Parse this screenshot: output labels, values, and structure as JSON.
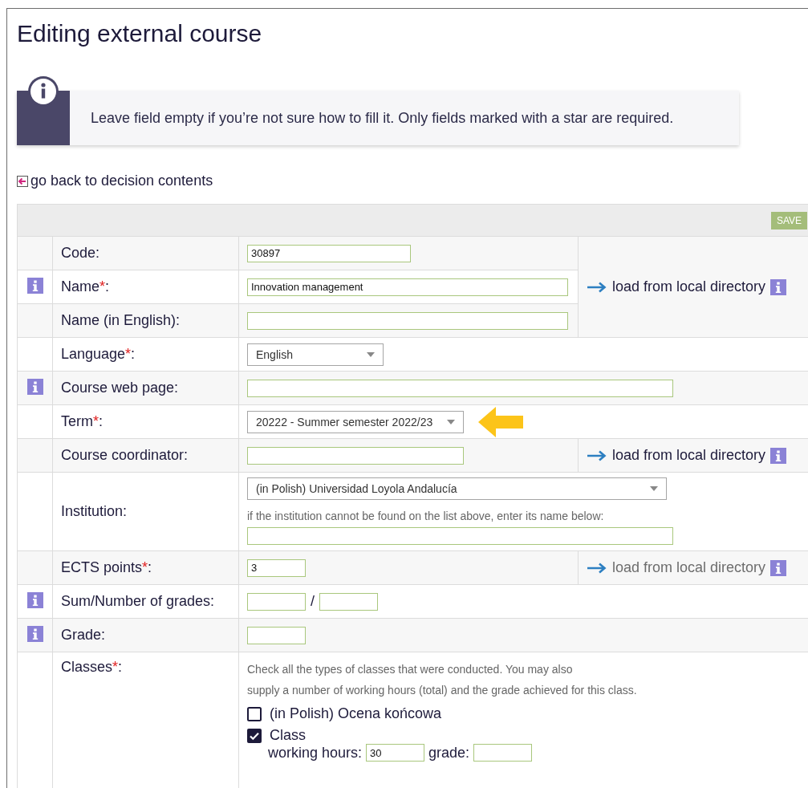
{
  "page": {
    "title": "Editing external course"
  },
  "notice": {
    "text": "Leave field empty if you’re not sure how to fill it. Only fields marked with a star are required."
  },
  "back_link": {
    "label": "go back to decision contents"
  },
  "form": {
    "save_button": "SAVE",
    "rows": [
      {
        "kind": "group",
        "side": {
          "label": "load from local directory",
          "disabled": false
        },
        "rows": [
          {
            "kind": "text",
            "label": "Code:",
            "info": false,
            "marked": false,
            "value": "30897"
          },
          {
            "kind": "text",
            "label": "Name",
            "required_mark": "*",
            "label_end": ":",
            "info": true,
            "marked": false,
            "value": "Innovation management"
          },
          {
            "kind": "text",
            "label": "Name (in English):",
            "info": false,
            "marked": false
          }
        ]
      },
      {
        "kind": "select",
        "label": "Language",
        "required_mark": "*",
        "label_end": ":",
        "info": false,
        "marked": false,
        "value": "English"
      },
      {
        "kind": "text",
        "label": "Course web page:",
        "info": true,
        "marked": false
      },
      {
        "kind": "select",
        "label": "Term",
        "required_mark": "*",
        "label_end": ":",
        "info": false,
        "marked": true,
        "value": "20222 - Summer semester 2022/23"
      },
      {
        "kind": "text",
        "label": "Course coordinator:",
        "info": false,
        "marked": false,
        "side": {
          "label": "load from local directory",
          "disabled": false
        }
      },
      {
        "kind": "institution",
        "label": "Institution:",
        "info": false,
        "marked": false,
        "value": "(in Polish) Universidad Loyola Andalucía",
        "hint": "if the institution cannot be found on the list above, enter its name below:"
      },
      {
        "kind": "text",
        "label": "ECTS points",
        "required_mark": "*",
        "label_end": ":",
        "info": false,
        "marked": false,
        "value": "3",
        "side": {
          "label": "load from local directory",
          "disabled": true
        }
      },
      {
        "kind": "pair",
        "label": "Sum/Number of grades:",
        "info": true,
        "marked": false,
        "separator": "/"
      },
      {
        "kind": "text",
        "label": "Grade:",
        "info": true,
        "marked": false
      },
      {
        "kind": "classes",
        "label": "Classes",
        "required_mark": "*",
        "label_end": ":",
        "info": false,
        "marked": false,
        "note_lines": [
          "Check all the types of classes that were conducted. You may also",
          "supply a number of working hours (total) and the grade achieved for this class."
        ],
        "options": [
          {
            "label": "(in Polish) Ocena końcowa",
            "checked": false
          },
          {
            "label": "Class",
            "checked": true,
            "hours_label": "working hours:",
            "hours": "30",
            "grade_label": "grade:"
          }
        ]
      }
    ]
  }
}
